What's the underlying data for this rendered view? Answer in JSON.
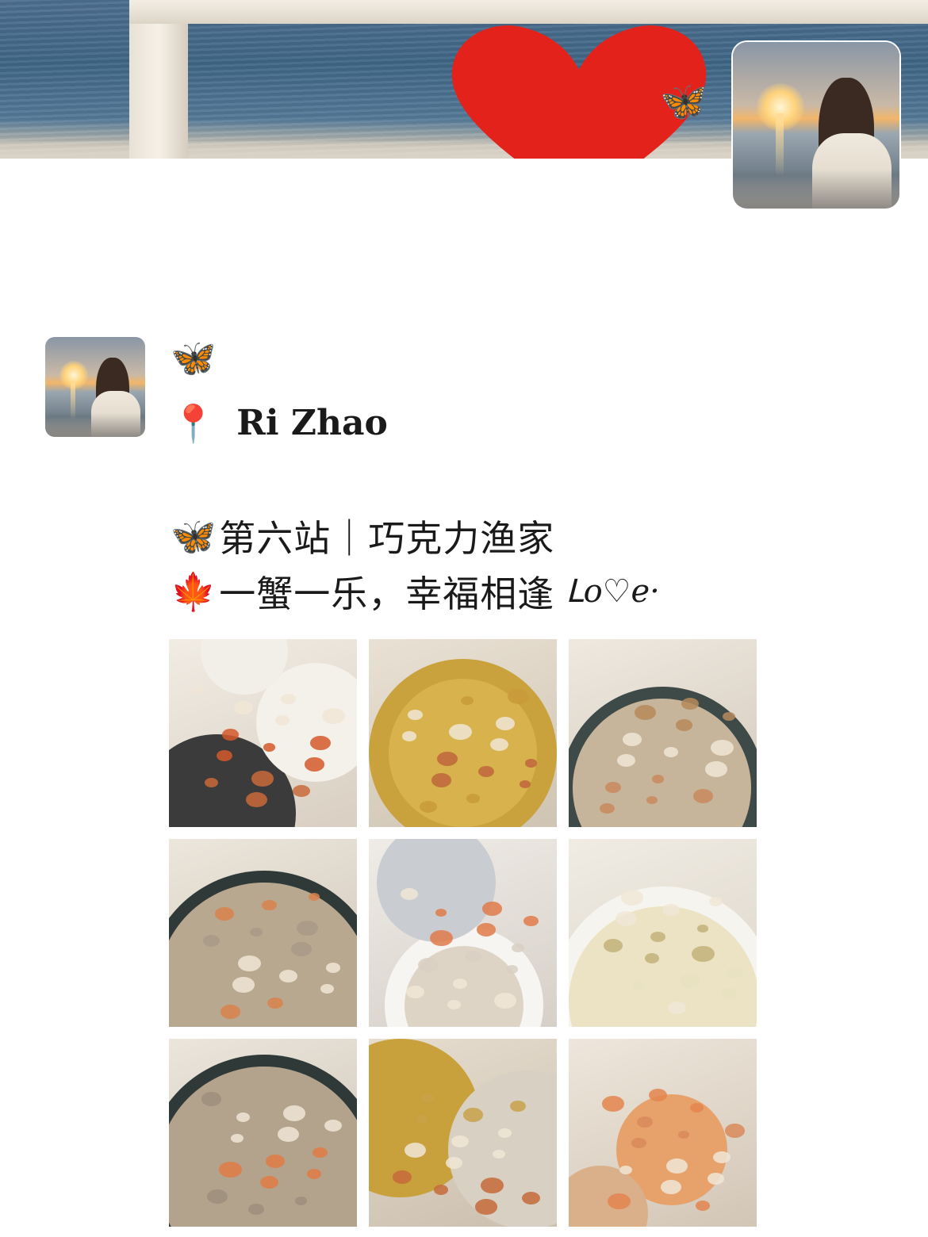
{
  "cover": {
    "butterfly_icon": "🦋"
  },
  "post": {
    "butterfly_icon": "🦋",
    "location_pin_icon": "📍",
    "location_text": "Ri Zhao",
    "title_icon": "🦋",
    "title_text": "第六站｜巧克力渔家",
    "desc_icon": "🍁",
    "desc_text": "一蟹一乐，幸福相逢",
    "desc_decoration": "ᒪo♡e·"
  },
  "photos": [
    {
      "label": "seafood-spread-photo",
      "theme": "#c96a3a"
    },
    {
      "label": "pasta-in-gold-wok-photo",
      "theme": "#c99a3a"
    },
    {
      "label": "scallops-and-oysters-photo",
      "theme": "#b58a5a"
    },
    {
      "label": "oyster-platter-photo",
      "theme": "#a89a88"
    },
    {
      "label": "shrimp-dish-with-lid-photo",
      "theme": "#d9cfc3"
    },
    {
      "label": "dumplings-photo",
      "theme": "#e9e2c0"
    },
    {
      "label": "oysters-and-shrimp-photo",
      "theme": "#9c8f7c"
    },
    {
      "label": "pasta-and-shellfish-photo",
      "theme": "#c9a24a"
    },
    {
      "label": "scallop-with-chopsticks-photo",
      "theme": "#d98a5a"
    }
  ]
}
